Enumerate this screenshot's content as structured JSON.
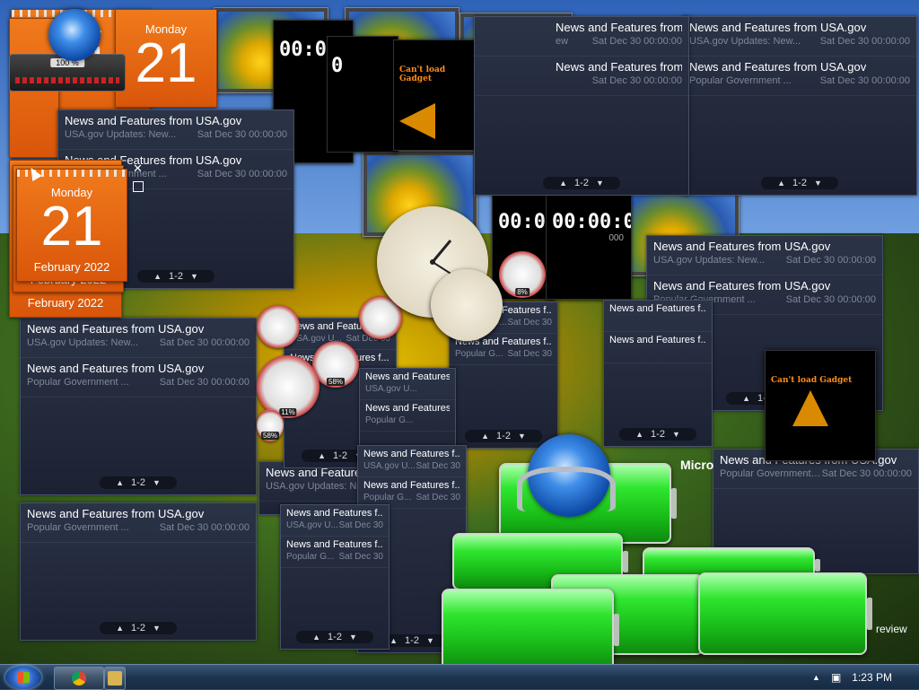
{
  "news_gadget": {
    "headline": "News and Features from USA.gov",
    "headline_short": "News and Features f...",
    "item1_source": "USA.gov Updates: New...",
    "item1_source_short": "USA.gov U...",
    "item2_source": "Popular Government ...",
    "item2_source_short": "Popular G...",
    "date": "Sat Dec 30 00:00:00",
    "date_short": "Sat Dec 30",
    "pager": "1-2",
    "pager_up": "▲",
    "pager_down": "▼"
  },
  "calendar": {
    "weekday": "Monday",
    "day": "21",
    "month_year": "February 2022"
  },
  "clock": {
    "digital_time": "00:00:00",
    "digital_partial": "00:0"
  },
  "cant_load": "Can't load Gadget",
  "cpu_meter": {
    "percent_label": "100 %"
  },
  "gauges": [
    "8%",
    "58%",
    "11%",
    "58%"
  ],
  "background_text": {
    "micro": "Micro",
    "preview": "review"
  },
  "taskbar": {
    "time": "1:23 PM",
    "apps": [
      {
        "name": "chrome",
        "color": "#e8b400"
      },
      {
        "name": "explorer",
        "color": "#d9b452"
      }
    ],
    "show_hidden": "▲"
  },
  "close_glyph": "✕"
}
